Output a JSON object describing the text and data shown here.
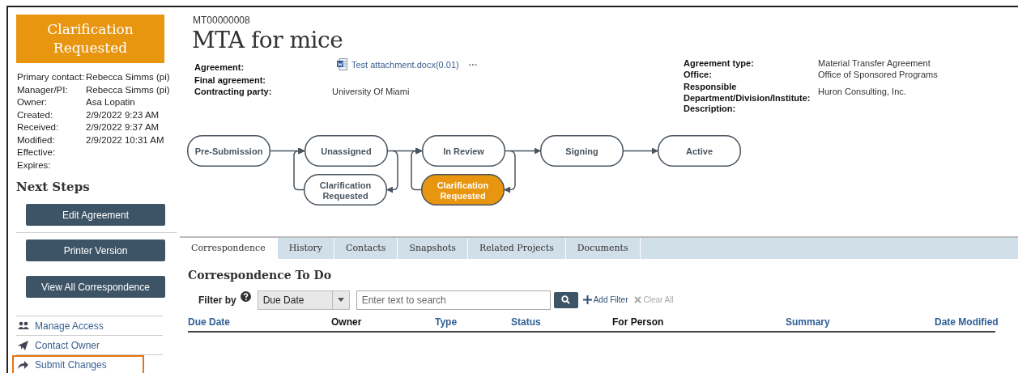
{
  "sidebar": {
    "status": "Clarification Requested",
    "details": [
      {
        "label": "Primary contact:",
        "value": "Rebecca Simms (pi)"
      },
      {
        "label": "Manager/PI:",
        "value": "Rebecca Simms (pi)"
      },
      {
        "label": "Owner:",
        "value": "Asa Lopatin"
      },
      {
        "label": "Created:",
        "value": "2/9/2022 9:23 AM"
      },
      {
        "label": "Received:",
        "value": "2/9/2022 9:37 AM"
      },
      {
        "label": "Modified:",
        "value": "2/9/2022 10:31 AM"
      },
      {
        "label": "Effective:"
      },
      {
        "label": "Expires:"
      }
    ],
    "next_steps_title": "Next Steps",
    "buttons": [
      "Edit Agreement",
      "Printer Version",
      "View All Correspondence"
    ],
    "links": [
      {
        "label": "Manage Access",
        "highlighted": false
      },
      {
        "label": "Contact Owner",
        "highlighted": false
      },
      {
        "label": "Submit Changes",
        "highlighted": true
      }
    ]
  },
  "header": {
    "id": "MT00000008",
    "title": "MTA for mice"
  },
  "fields_left": [
    {
      "label": "Agreement:",
      "value": "Test attachment.docx(0.01)",
      "kind": "attachment",
      "more": "···"
    },
    {
      "label": "Final agreement:"
    },
    {
      "label": "Contracting party:",
      "value": "University Of Miami",
      "kind": "text"
    }
  ],
  "fields_right": [
    {
      "label": "Agreement type:",
      "value": "Material Transfer Agreement"
    },
    {
      "label": "Office:",
      "value": "Office of Sponsored Programs"
    },
    {
      "label": "Responsible Department/Division/Institute:",
      "value": "Huron Consulting, Inc."
    },
    {
      "label": "Description:"
    }
  ],
  "workflow": {
    "stages": [
      {
        "label": "Pre-Submission",
        "current": false
      },
      {
        "label": "Unassigned",
        "current": false,
        "clarification": {
          "label": "Clarification Requested",
          "current": false
        }
      },
      {
        "label": "In Review",
        "current": false,
        "clarification": {
          "label": "Clarification Requested",
          "current": true
        }
      },
      {
        "label": "Signing",
        "current": false
      },
      {
        "label": "Active",
        "current": false
      }
    ]
  },
  "tabs": [
    {
      "label": "Correspondence",
      "selected": true
    },
    {
      "label": "History",
      "selected": false
    },
    {
      "label": "Contacts",
      "selected": false
    },
    {
      "label": "Snapshots",
      "selected": false
    },
    {
      "label": "Related Projects",
      "selected": false
    },
    {
      "label": "Documents",
      "selected": false
    }
  ],
  "panel": {
    "title": "Correspondence To Do",
    "filter_label": "Filter by",
    "filter_field": "Due Date",
    "search": {
      "placeholder": "Enter text to search"
    },
    "add_filter": "Add Filter",
    "clear_all": {
      "label": "Clear All",
      "disabled": true
    }
  },
  "table": {
    "columns": [
      {
        "label": "Due Date",
        "sortable": true
      },
      {
        "label": "Owner",
        "sortable": false
      },
      {
        "label": "Type",
        "sortable": true
      },
      {
        "label": "Status",
        "sortable": true
      },
      {
        "label": "For Person",
        "sortable": false
      },
      {
        "label": "Summary",
        "sortable": true
      },
      {
        "label": "Date Modified",
        "sortable": true
      }
    ]
  }
}
